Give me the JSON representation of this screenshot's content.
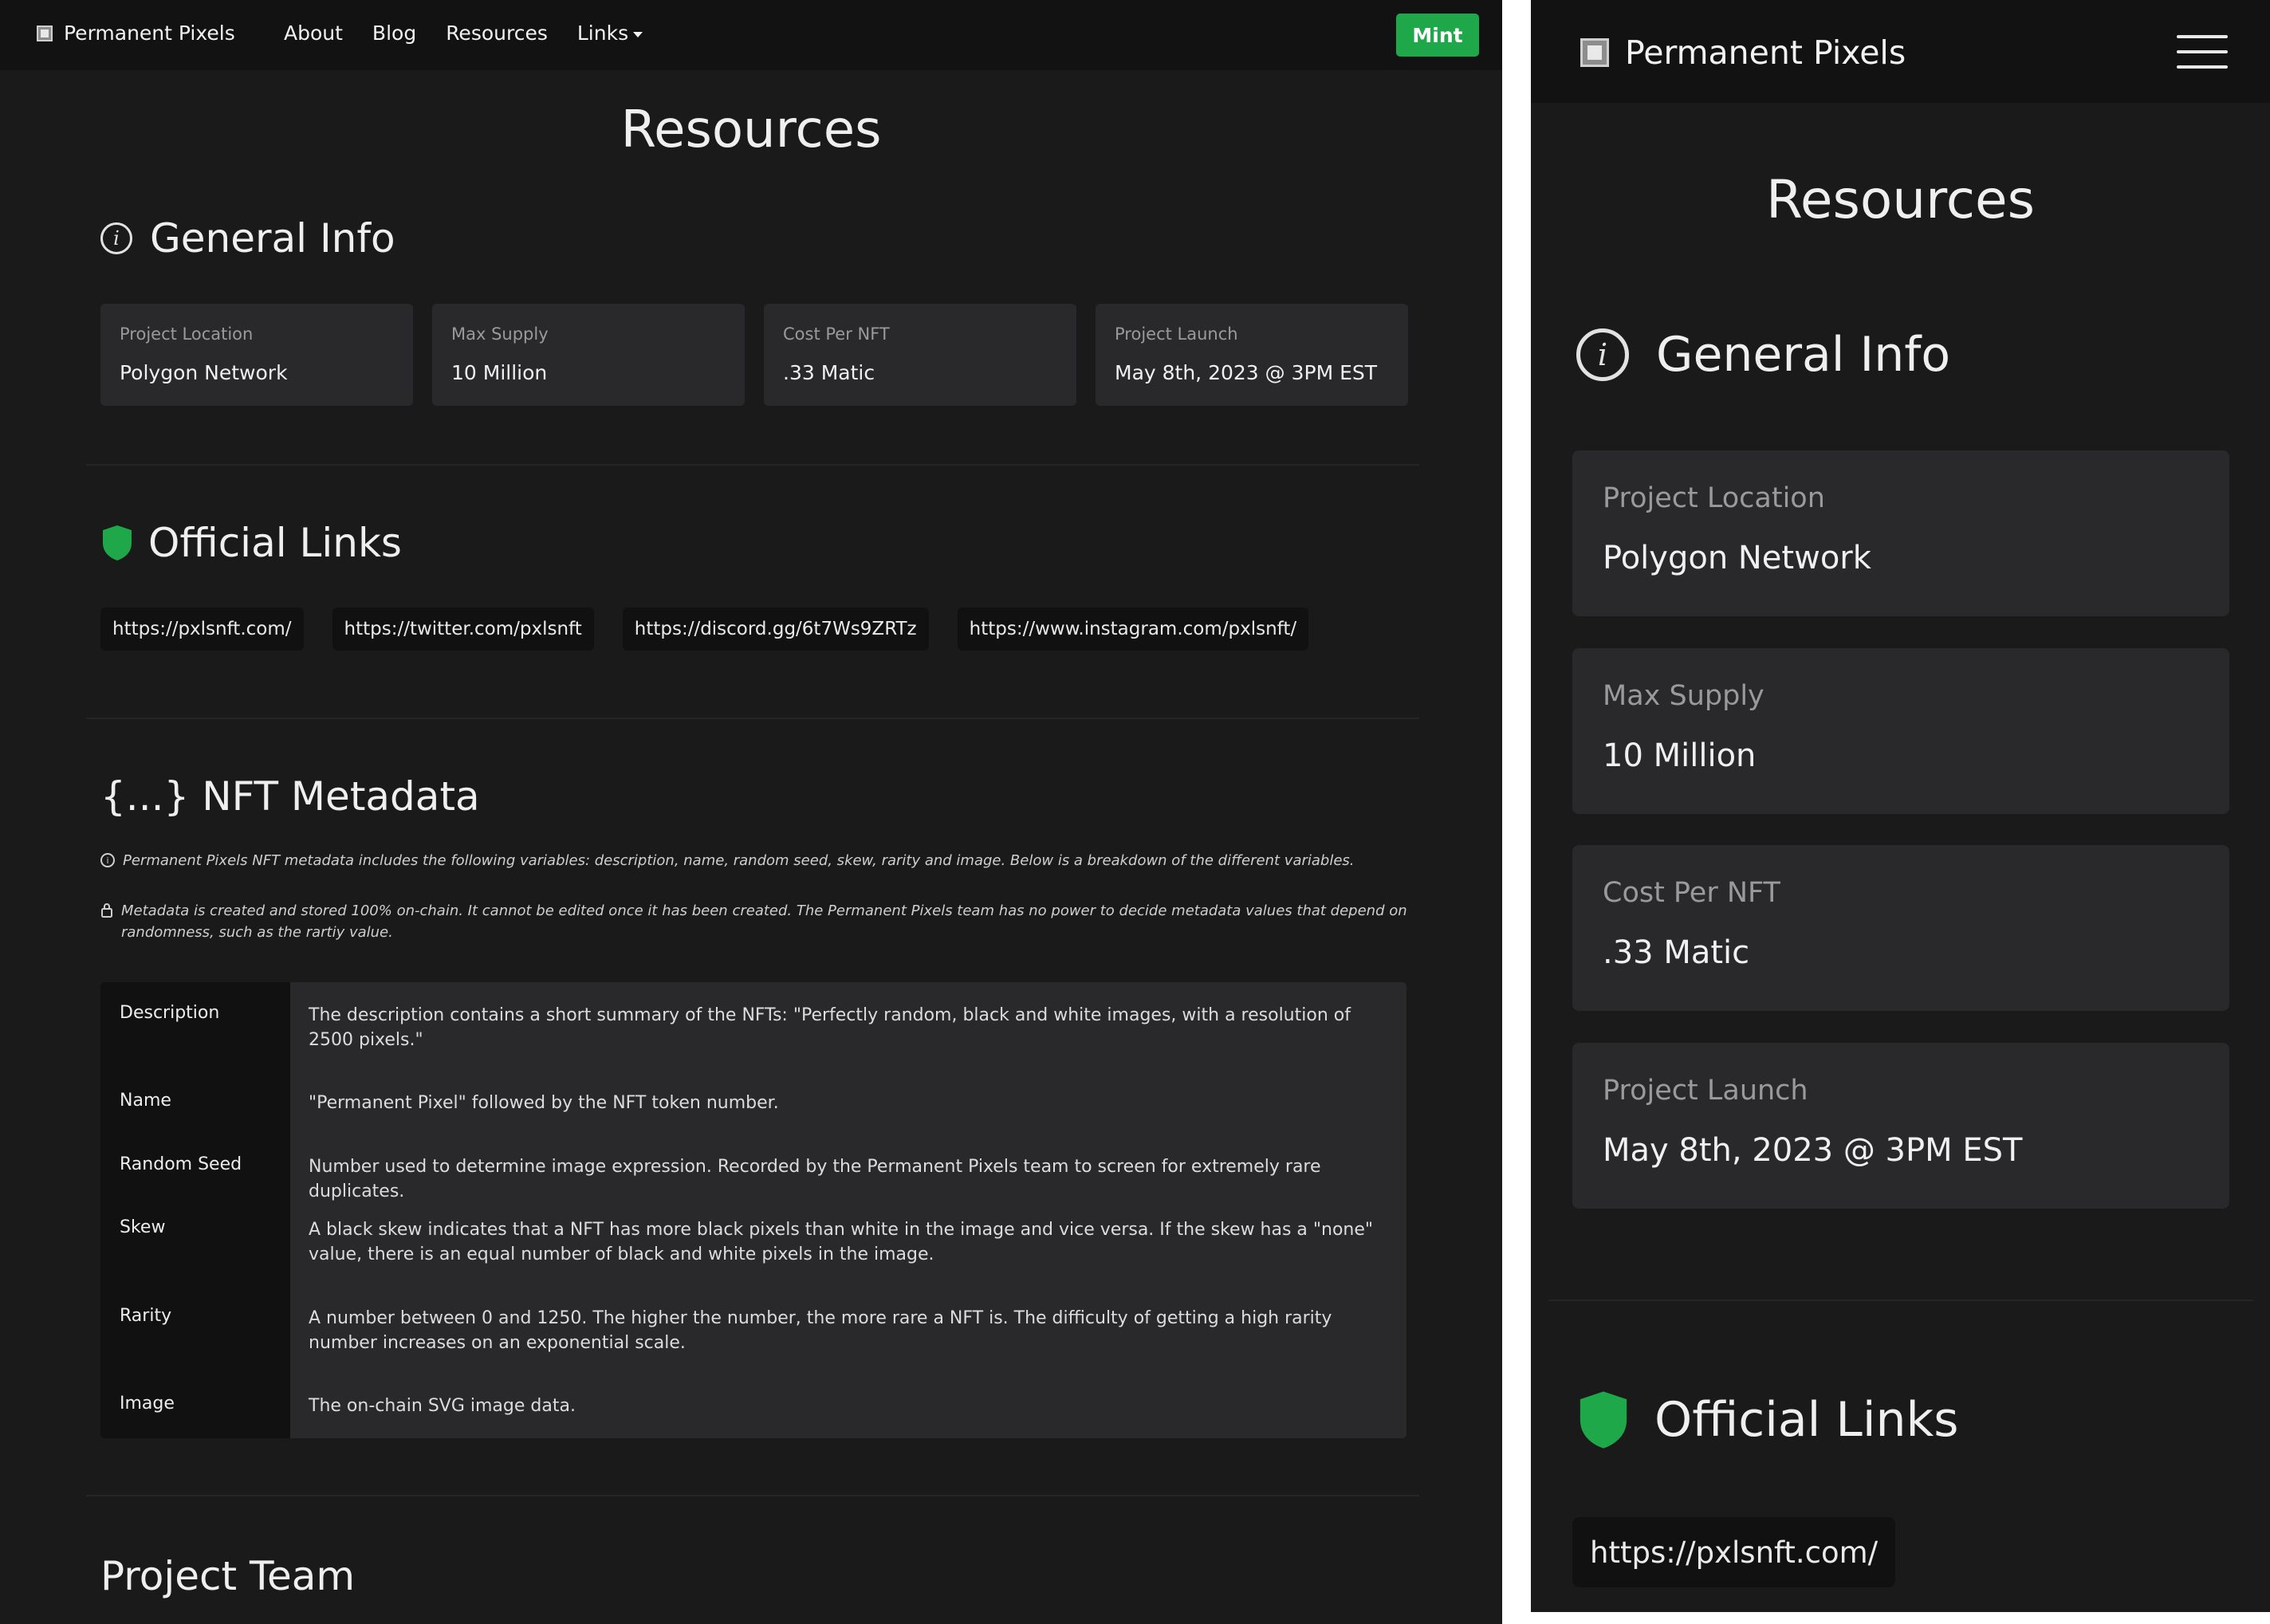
{
  "brand": {
    "name": "Permanent Pixels"
  },
  "nav": {
    "about": "About",
    "blog": "Blog",
    "resources": "Resources",
    "links": "Links",
    "mint": "Mint"
  },
  "page": {
    "title": "Resources"
  },
  "general_info": {
    "title": "General Info",
    "cards": [
      {
        "label": "Project Location",
        "value": "Polygon Network"
      },
      {
        "label": "Max Supply",
        "value": "10 Million"
      },
      {
        "label": "Cost Per NFT",
        "value": ".33 Matic"
      },
      {
        "label": "Project Launch",
        "value": "May 8th, 2023 @ 3PM EST"
      }
    ]
  },
  "official_links": {
    "title": "Official Links",
    "links": [
      "https://pxlsnft.com/",
      "https://twitter.com/pxlsnft",
      "https://discord.gg/6t7Ws9ZRTz",
      "https://www.instagram.com/pxlsnft/"
    ]
  },
  "metadata": {
    "title": "{...} NFT Metadata",
    "note_info": "Permanent Pixels NFT metadata includes the following variables: description, name, random seed, skew, rarity and image. Below is a breakdown of the different variables.",
    "note_lock": "Metadata is created and stored 100% on-chain. It cannot be edited once it has been created. The Permanent Pixels team has no power to decide metadata values that depend on randomness, such as the rartiy value.",
    "rows": [
      {
        "key": "Description",
        "value": "The description contains a short summary of the NFTs: \"Perfectly random, black and white images, with a resolution of 2500 pixels.\""
      },
      {
        "key": "Name",
        "value": "\"Permanent Pixel\" followed by the NFT token number."
      },
      {
        "key": "Random Seed",
        "value": "Number used to determine image expression. Recorded by the Permanent Pixels team to screen for extremely rare duplicates."
      },
      {
        "key": "Skew",
        "value": "A black skew indicates that a NFT has more black pixels than white in the image and vice versa. If the skew has a \"none\" value, there is an equal number of black and white pixels in the image."
      },
      {
        "key": "Rarity",
        "value": "A number between 0 and 1250. The higher the number, the more rare a NFT is. The difficulty of getting a high rarity number increases on an exponential scale."
      },
      {
        "key": "Image",
        "value": "The on-chain SVG image data."
      }
    ]
  },
  "team": {
    "title": "Project Team"
  },
  "colors": {
    "accent_green": "#1ea84a",
    "background": "#1a1a1b",
    "card": "#29292b"
  },
  "icons": {
    "info": "info-icon",
    "shield": "shield-icon",
    "lock": "lock-icon",
    "menu": "hamburger-icon",
    "dropdown": "caret-down-icon"
  }
}
